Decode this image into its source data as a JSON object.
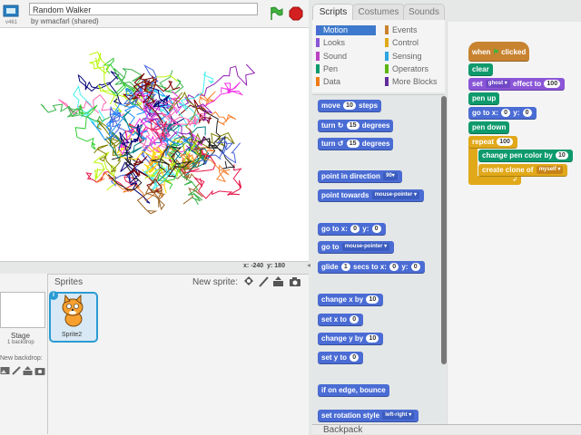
{
  "topbar": {
    "version": "v461",
    "project_title": "Random Walker",
    "byline": "by wmacfarl (shared)"
  },
  "stage": {
    "x_label": "x:",
    "x_value": "-240",
    "y_label": "y:",
    "y_value": "180"
  },
  "sprites_panel": {
    "sprites_label": "Sprites",
    "new_sprite_label": "New sprite:",
    "stage_label": "Stage",
    "backdrop_count": "1 backdrop",
    "new_backdrop_label": "New backdrop:",
    "sprite_name": "Sprite2",
    "info_icon_text": "i"
  },
  "tabs": [
    "Scripts",
    "Costumes",
    "Sounds"
  ],
  "categories": [
    {
      "label": "Motion",
      "color": "#4a6cd4",
      "selected": true
    },
    {
      "label": "Events",
      "color": "#c88330"
    },
    {
      "label": "Looks",
      "color": "#8a55d7"
    },
    {
      "label": "Control",
      "color": "#e1a91a"
    },
    {
      "label": "Sound",
      "color": "#bb42c3"
    },
    {
      "label": "Sensing",
      "color": "#2ca5e2"
    },
    {
      "label": "Pen",
      "color": "#0e9a6c"
    },
    {
      "label": "Operators",
      "color": "#5cb712"
    },
    {
      "label": "Data",
      "color": "#ee7d16"
    },
    {
      "label": "More Blocks",
      "color": "#632d99"
    }
  ],
  "palette": {
    "move": {
      "a": "move",
      "v": "10",
      "b": "steps"
    },
    "turn_right": {
      "a": "turn",
      "icon": "↻",
      "v": "15",
      "b": "degrees"
    },
    "turn_left": {
      "a": "turn",
      "icon": "↺",
      "v": "15",
      "b": "degrees"
    },
    "point_dir": {
      "a": "point in direction",
      "v": "90▾"
    },
    "point_towards": {
      "a": "point towards",
      "v": "mouse-pointer ▾"
    },
    "goto_xy": {
      "a": "go to x:",
      "x": "0",
      "b": "y:",
      "y": "0"
    },
    "goto": {
      "a": "go to",
      "v": "mouse-pointer ▾"
    },
    "glide": {
      "a": "glide",
      "s": "1",
      "b": "secs to x:",
      "x": "0",
      "c": "y:",
      "y": "0"
    },
    "change_x": {
      "a": "change x by",
      "v": "10"
    },
    "set_x": {
      "a": "set x to",
      "v": "0"
    },
    "change_y": {
      "a": "change y by",
      "v": "10"
    },
    "set_y": {
      "a": "set y to",
      "v": "0"
    },
    "bounce": {
      "a": "if on edge, bounce"
    },
    "rot_style": {
      "a": "set rotation style",
      "v": "left-right ▾"
    }
  },
  "script": {
    "when_flag_a": "when",
    "when_flag_b": "clicked",
    "clear": "clear",
    "set_effect_a": "set",
    "set_effect_dd": "ghost ▾",
    "set_effect_b": "effect to",
    "set_effect_v": "100",
    "pen_up": "pen up",
    "goto_a": "go to x:",
    "goto_x": "0",
    "goto_b": "y:",
    "goto_y": "0",
    "pen_down": "pen down",
    "repeat_a": "repeat",
    "repeat_v": "100",
    "change_pen_a": "change pen color by",
    "change_pen_v": "10",
    "clone_a": "create clone of",
    "clone_dd": "myself ▾"
  },
  "backpack_label": "Backpack",
  "colors": {
    "motion": "#4a6cd4",
    "looks": "#8a55d7",
    "pen": "#0e9a6c",
    "control": "#e1a91a",
    "events": "#c88330",
    "selection": "#2a9bd4"
  }
}
